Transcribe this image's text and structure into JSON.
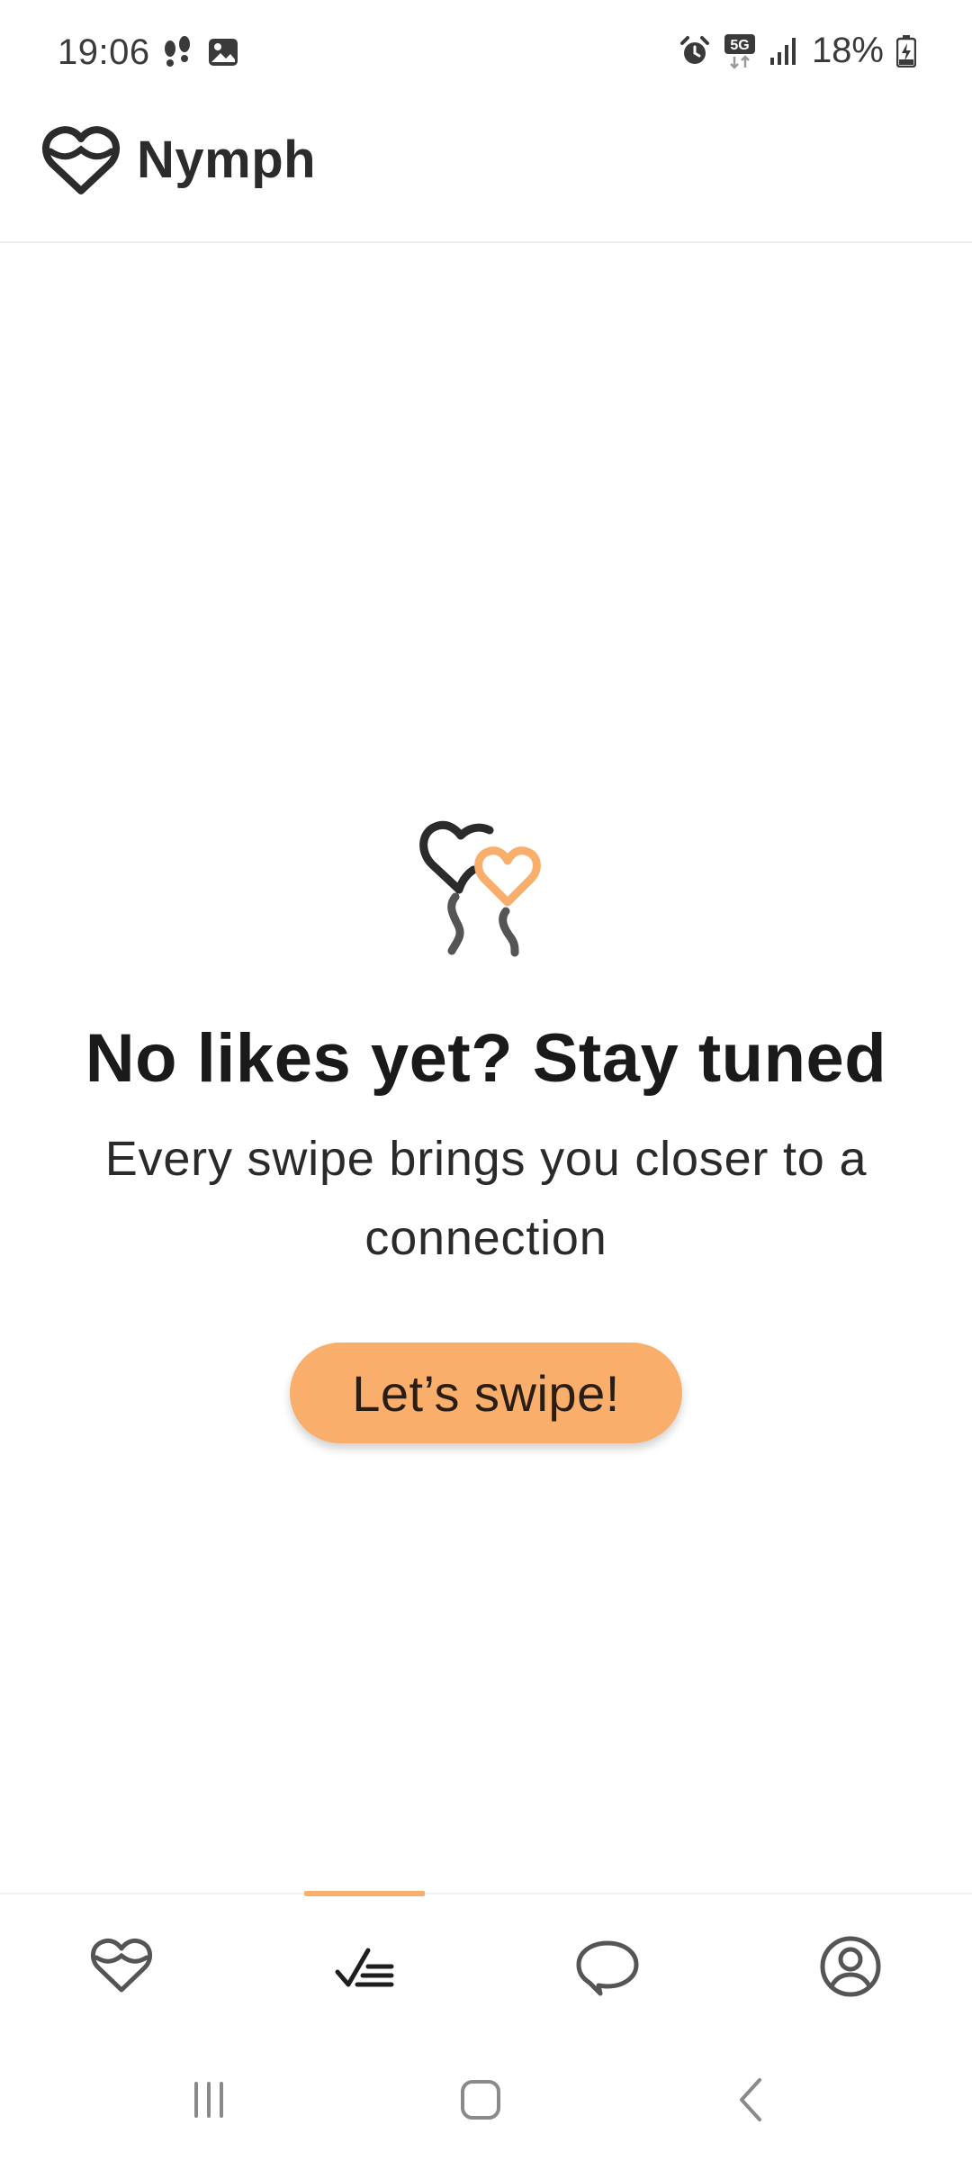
{
  "status_bar": {
    "time": "19:06",
    "left_icons": [
      "steps-icon",
      "gallery-icon"
    ],
    "right_icons": [
      "alarm-icon",
      "5g-icon",
      "signal-icon"
    ],
    "battery": "18%"
  },
  "header": {
    "app_name": "Nymph",
    "logo_icon": "nymph-heart-logo-icon"
  },
  "empty_state": {
    "illustration": "heart-balloons-icon",
    "title": "No likes yet? Stay tuned",
    "subtitle": "Every swipe brings you closer to a connection",
    "button_label": "Let’s swipe!"
  },
  "bottom_nav": {
    "items": [
      {
        "icon": "discover-heart-icon",
        "active": false
      },
      {
        "icon": "likes-checklist-icon",
        "active": true
      },
      {
        "icon": "chat-bubble-icon",
        "active": false
      },
      {
        "icon": "profile-icon",
        "active": false
      }
    ]
  },
  "system_nav": [
    "recents-icon",
    "home-icon",
    "back-icon"
  ],
  "colors": {
    "accent": "#f9ae6c",
    "text_primary": "#1a1a1a",
    "icon_dark": "#2b2b2b"
  }
}
